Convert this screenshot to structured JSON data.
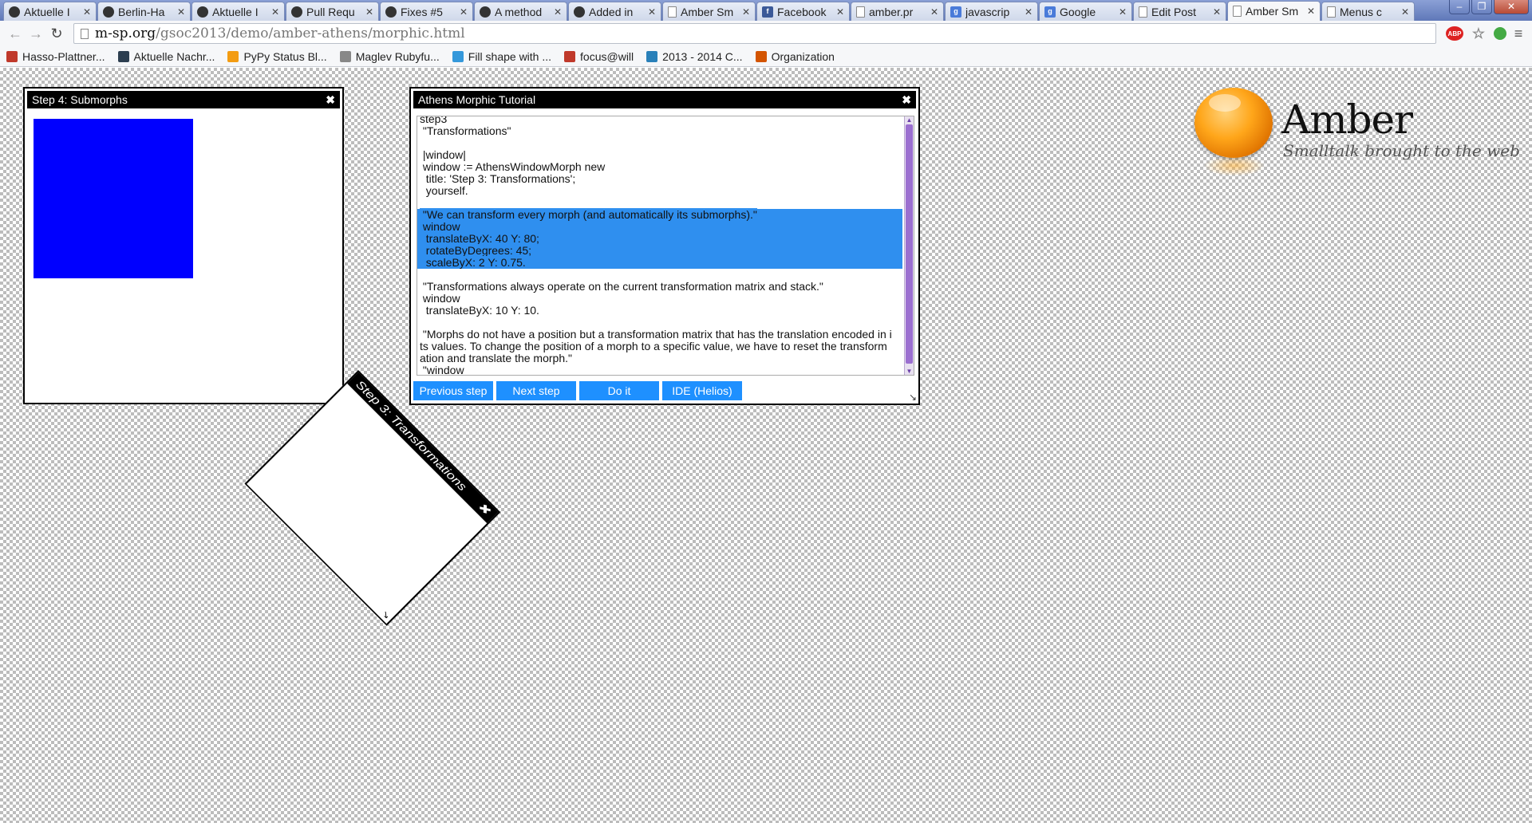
{
  "tabs": [
    {
      "label": "Aktuelle I",
      "icon": "site-icon"
    },
    {
      "label": "Berlin-Ha",
      "icon": "globe-icon"
    },
    {
      "label": "Aktuelle I",
      "icon": "site-icon"
    },
    {
      "label": "Pull Requ",
      "icon": "github-icon"
    },
    {
      "label": "Fixes #5",
      "icon": "github-icon"
    },
    {
      "label": "A method",
      "icon": "github-icon"
    },
    {
      "label": "Added in",
      "icon": "github-icon"
    },
    {
      "label": "Amber Sm",
      "icon": "page-icon"
    },
    {
      "label": "Facebook",
      "icon": "facebook-icon"
    },
    {
      "label": "amber.pr",
      "icon": "page-icon"
    },
    {
      "label": "javascrip",
      "icon": "google-icon"
    },
    {
      "label": "Google",
      "icon": "google-icon"
    },
    {
      "label": "Edit Post",
      "icon": "page-icon"
    },
    {
      "label": "Amber Sm",
      "icon": "page-icon",
      "active": true
    },
    {
      "label": "Menus c",
      "icon": "page-icon"
    }
  ],
  "address": {
    "host": "m-sp.org",
    "path": "/gsoc2013/demo/amber-athens/morphic.html"
  },
  "bookmarks": [
    {
      "label": "Hasso-Plattner...",
      "color": "#c0392b"
    },
    {
      "label": "Aktuelle Nachr...",
      "color": "#2c3e50"
    },
    {
      "label": "PyPy Status Bl...",
      "color": "#f39c12"
    },
    {
      "label": "Maglev Rubyfu...",
      "color": "#888888"
    },
    {
      "label": "Fill shape with ...",
      "color": "#3498db"
    },
    {
      "label": "focus@will",
      "color": "#c0392b"
    },
    {
      "label": "2013 - 2014 C...",
      "color": "#2980b9"
    },
    {
      "label": "Organization",
      "color": "#d35400"
    }
  ],
  "step4_window": {
    "title": "Step 4: Submorphs",
    "box_color": "#0000ff"
  },
  "tutorial_window": {
    "title": "Athens Morphic Tutorial",
    "code_lines": [
      {
        "text": "step3",
        "selected": false
      },
      {
        "text": " \"Transformations\"",
        "selected": false
      },
      {
        "text": "",
        "selected": false
      },
      {
        "text": " |window|",
        "selected": false
      },
      {
        "text": " window := AthensWindowMorph new",
        "selected": false
      },
      {
        "text": "  title: 'Step 3: Transformations';",
        "selected": false
      },
      {
        "text": "  yourself.",
        "selected": false
      },
      {
        "text": "",
        "selected": false
      },
      {
        "text": " \"We can transform every morph (and automatically its submorphs).\"",
        "selected": true
      },
      {
        "text": " window",
        "selected": true
      },
      {
        "text": "  translateByX: 40 Y: 80;",
        "selected": true
      },
      {
        "text": "  rotateByDegrees: 45;",
        "selected": true
      },
      {
        "text": "  scaleByX: 2 Y: 0.75.",
        "selected": true
      },
      {
        "text": "",
        "selected": false
      },
      {
        "text": " \"Transformations always operate on the current transformation matrix and stack.\"",
        "selected": false
      },
      {
        "text": " window",
        "selected": false
      },
      {
        "text": "  translateByX: 10 Y: 10.",
        "selected": false
      },
      {
        "text": "",
        "selected": false
      },
      {
        "text": " \"Morphs do not have a position but a transformation matrix that has the translation encoded in i",
        "selected": false
      },
      {
        "text": "ts values. To change the position of a morph to a specific value, we have to reset the transform",
        "selected": false
      },
      {
        "text": "ation and translate the morph.\"",
        "selected": false
      },
      {
        "text": " \"window",
        "selected": false
      }
    ],
    "buttons": {
      "previous": "Previous step",
      "next": "Next step",
      "doit": "Do it",
      "ide": "IDE (Helios)"
    }
  },
  "transformed_window": {
    "title": "Step 3: Transformations"
  },
  "amber_logo": {
    "name": "Amber",
    "tagline": "Smalltalk brought to the web"
  }
}
